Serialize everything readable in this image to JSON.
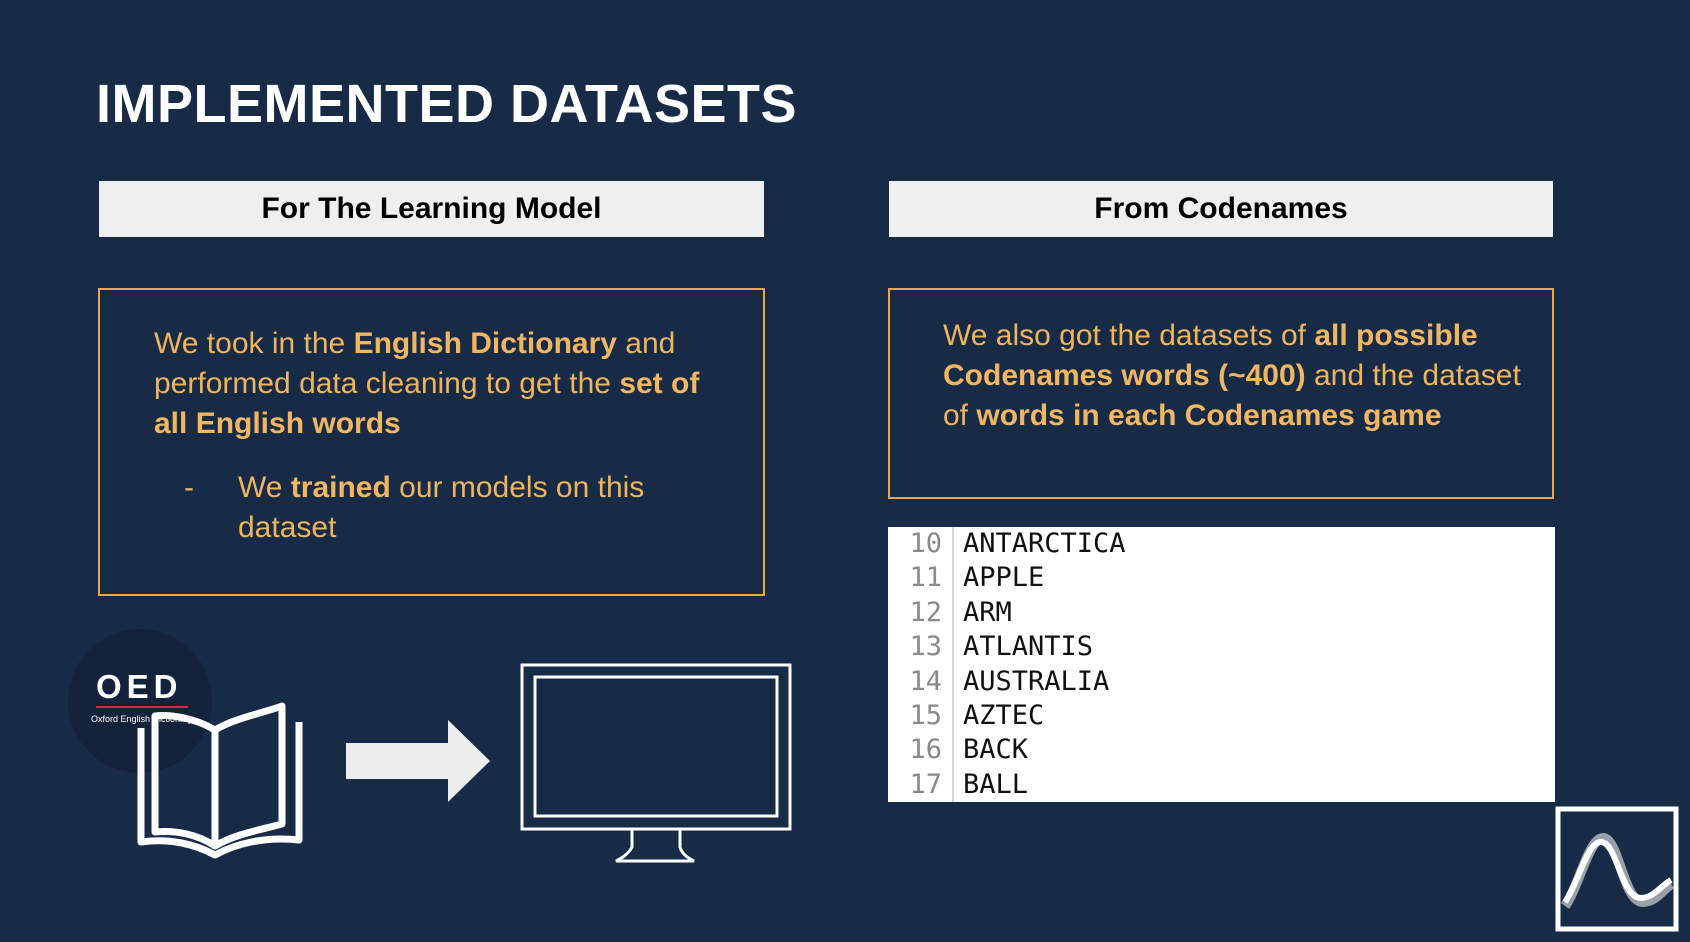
{
  "title": "IMPLEMENTED DATASETS",
  "left": {
    "header": "For The Learning Model",
    "para": [
      {
        "t": "We took in the "
      },
      {
        "t": "English Dictionary",
        "b": true
      },
      {
        "t": " and performed data cleaning to get the "
      },
      {
        "t": "set of all English words",
        "b": true
      }
    ],
    "bullet_marker": "-",
    "bullet": [
      {
        "t": "We "
      },
      {
        "t": "trained",
        "b": true
      },
      {
        "t": " our models on this dataset"
      }
    ]
  },
  "right": {
    "header": "From Codenames",
    "para": [
      {
        "t": "We also got the datasets of "
      },
      {
        "t": "all possible Codenames words (~400)",
        "b": true
      },
      {
        "t": " and the dataset of "
      },
      {
        "t": "words in each Codenames game",
        "b": true
      }
    ],
    "code_rows": [
      {
        "n": "10",
        "w": "ANTARCTICA"
      },
      {
        "n": "11",
        "w": "APPLE"
      },
      {
        "n": "12",
        "w": "ARM"
      },
      {
        "n": "13",
        "w": "ATLANTIS"
      },
      {
        "n": "14",
        "w": "AUSTRALIA"
      },
      {
        "n": "15",
        "w": "AZTEC"
      },
      {
        "n": "16",
        "w": "BACK"
      },
      {
        "n": "17",
        "w": "BALL"
      }
    ]
  },
  "oed": {
    "logo_text": "OED",
    "subtitle": "Oxford English Dictionary"
  },
  "icons": {
    "book": "open-book-icon",
    "arrow": "right-arrow-icon",
    "monitor": "monitor-icon",
    "corner": "wave-logo-icon"
  },
  "colors": {
    "background": "#172a46",
    "accent": "#f0b45c",
    "header_bg": "#efefef"
  }
}
